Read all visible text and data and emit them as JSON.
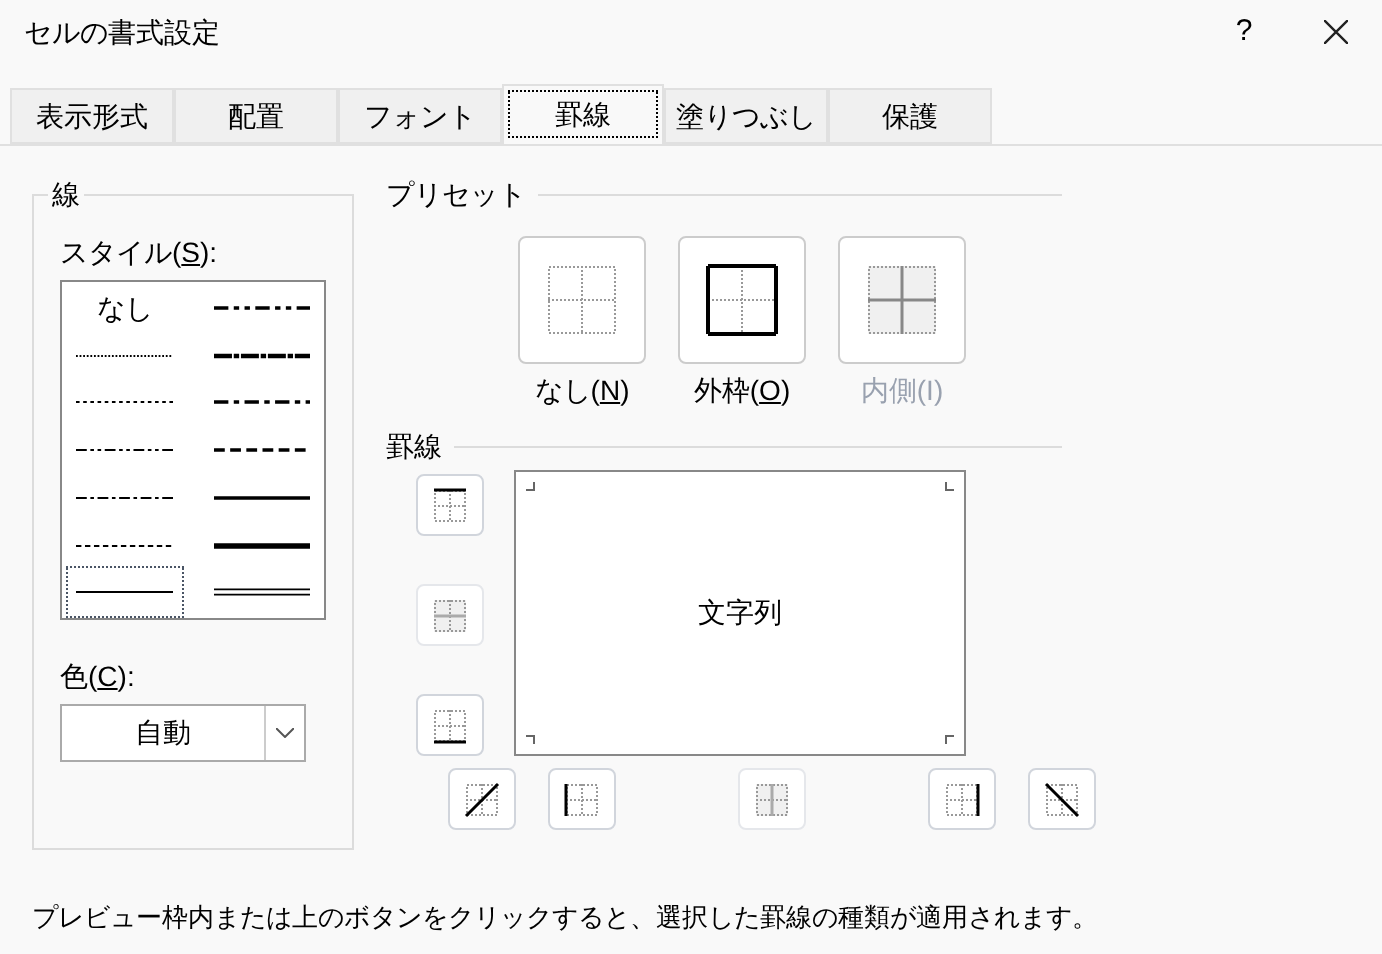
{
  "window": {
    "title": "セルの書式設定",
    "help": "?"
  },
  "tabs": [
    {
      "label": "表示形式",
      "selected": false
    },
    {
      "label": "配置",
      "selected": false
    },
    {
      "label": "フォント",
      "selected": false
    },
    {
      "label": "罫線",
      "selected": true
    },
    {
      "label": "塗りつぶし",
      "selected": false
    },
    {
      "label": "保護",
      "selected": false
    }
  ],
  "line_group": {
    "title": "線",
    "style_label": {
      "before": "スタイル(",
      "mnemonic": "S",
      "after": "):"
    },
    "styles": [
      {
        "kind": "none",
        "label": "なし",
        "selected": false
      },
      {
        "kind": "hair",
        "selected": false
      },
      {
        "kind": "dotted",
        "selected": false
      },
      {
        "kind": "dash-dot-dot",
        "selected": false
      },
      {
        "kind": "dash-dot",
        "selected": false
      },
      {
        "kind": "dashed",
        "selected": false
      },
      {
        "kind": "thin",
        "selected": true
      },
      {
        "kind": "medium-dash-dot-dot",
        "selected": false
      },
      {
        "kind": "slant-dash-dot",
        "selected": false
      },
      {
        "kind": "medium-dash-dot",
        "selected": false
      },
      {
        "kind": "medium-dashed",
        "selected": false
      },
      {
        "kind": "medium",
        "selected": false
      },
      {
        "kind": "thick",
        "selected": false
      },
      {
        "kind": "double",
        "selected": false
      }
    ],
    "color_label": {
      "before": "色(",
      "mnemonic": "C",
      "after": "):"
    },
    "color_value": "自動"
  },
  "presets": {
    "title": "プリセット",
    "items": [
      {
        "kind": "none",
        "before": "なし(",
        "mnemonic": "N",
        "after": ")",
        "disabled": false
      },
      {
        "kind": "outline",
        "before": "外枠(",
        "mnemonic": "O",
        "after": ")",
        "disabled": false
      },
      {
        "kind": "inside",
        "before": "内側(I)",
        "disabled": true
      }
    ]
  },
  "border": {
    "title": "罫線",
    "preview_text": "文字列",
    "left_buttons": [
      {
        "kind": "top",
        "disabled": false
      },
      {
        "kind": "middle-horizontal",
        "disabled": true
      },
      {
        "kind": "bottom",
        "disabled": false
      }
    ],
    "bottom_buttons": [
      {
        "kind": "diagonal-up",
        "disabled": false
      },
      {
        "kind": "left",
        "disabled": false
      },
      {
        "kind": "middle-vertical",
        "disabled": true
      },
      {
        "kind": "right",
        "disabled": false
      },
      {
        "kind": "diagonal-down",
        "disabled": false
      }
    ]
  },
  "footer": "プレビュー枠内または上のボタンをクリックすると、選択した罫線の種類が適用されます。"
}
